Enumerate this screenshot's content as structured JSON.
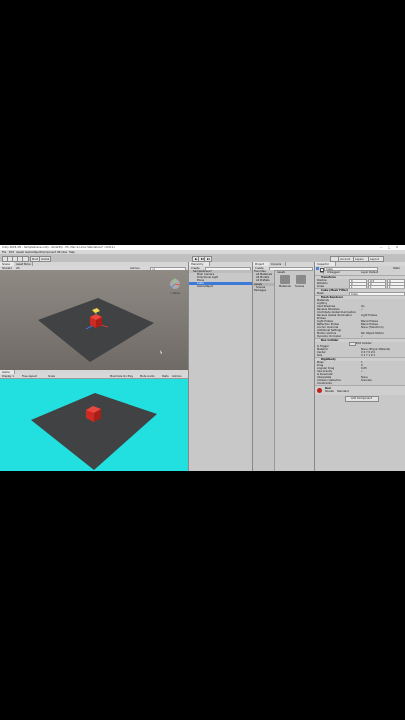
{
  "window": {
    "title": "Unity 2018.4f1 - SampleScene.unity - NodeTrip - PC, Mac & Linux Standalone* <DX11>",
    "controls": [
      "—",
      "□",
      "✕"
    ]
  },
  "menu": [
    "File",
    "Edit",
    "Assets",
    "GameObject",
    "Component",
    "Window",
    "Help"
  ],
  "toolbar": {
    "pivot_label": "Pivot",
    "global_label": "Global",
    "account_label": "Account",
    "layers_label": "Layers",
    "layout_label": "Layout"
  },
  "scene_view": {
    "tabs": [
      "Scene",
      "Asset Store"
    ],
    "shading_label": "Shaded",
    "mode_label": "2D",
    "gizmos_label": "Gizmos",
    "search_placeholder": "All",
    "persp_label": "< Persp"
  },
  "game_view": {
    "tabs": [
      "Game"
    ],
    "display_label": "Display 1",
    "aspect_label": "Free Aspect",
    "scale_label": "Scale",
    "maximize_label": "Maximize On Play",
    "mute_label": "Mute Audio",
    "stats_label": "Stats",
    "gizmos_label": "Gizmos",
    "background_color": "#22e0e0"
  },
  "hierarchy": {
    "tab_label": "Hierarchy",
    "create_label": "Create",
    "scene_name": "SampleScene*",
    "items": [
      "Main Camera",
      "Directional Light",
      "Plane",
      "Cube",
      "GameObject"
    ],
    "selected_item": "Cube"
  },
  "project": {
    "tab_label": "Project",
    "console_label": "Console",
    "create_label": "Create",
    "breadcrumb": "Assets",
    "tree": [
      "Favorites",
      "All Materials",
      "All Models",
      "All Prefabs",
      "Assets",
      "Scenes",
      "Packages"
    ],
    "assets": [
      "Materials",
      "Scenes"
    ]
  },
  "inspector": {
    "tab_label": "Inspector",
    "name": "Cube",
    "static_label": "Static",
    "tag_label": "Tag",
    "tag_value": "Untagged",
    "layer_label": "Layer",
    "layer_value": "Default",
    "transform": {
      "title": "Transform",
      "position_label": "Position",
      "rotation_label": "Rotation",
      "scale_label": "Scale",
      "position": [
        "0",
        "0.5",
        "0"
      ],
      "rotation": [
        "0",
        "0",
        "0"
      ],
      "scale": [
        "1",
        "1",
        "1"
      ]
    },
    "mesh_filter": {
      "title": "Cube (Mesh Filter)",
      "mesh_label": "Mesh",
      "mesh_value": "Cube"
    },
    "mesh_renderer": {
      "title": "Mesh Renderer",
      "rows": [
        [
          "Materials",
          ""
        ],
        [
          "Lighting",
          ""
        ],
        [
          "Cast Shadows",
          "On"
        ],
        [
          "Receive Shadows",
          "✓"
        ],
        [
          "Contribute Global Illumination",
          ""
        ],
        [
          "Receive Global Illumination",
          "Light Probes"
        ],
        [
          "Probes",
          ""
        ],
        [
          "Light Probes",
          "Blend Probes"
        ],
        [
          "Reflection Probes",
          "Blend Probes"
        ],
        [
          "Anchor Override",
          "None (Transform)"
        ],
        [
          "Additional Settings",
          ""
        ],
        [
          "Motion Vectors",
          "Per Object Motion"
        ],
        [
          "Dynamic Occluded",
          "✓"
        ]
      ]
    },
    "box_collider": {
      "title": "Box Collider",
      "edit_label": "Edit Collider",
      "rows": [
        [
          "Is Trigger",
          ""
        ],
        [
          "Material",
          "None (Physic Material)"
        ],
        [
          "Center",
          "X 0  Y 0  Z 0"
        ],
        [
          "Size",
          "X 1  Y 1  Z 1"
        ]
      ]
    },
    "rigidbody": {
      "title": "Rigidbody",
      "rows": [
        [
          "Mass",
          "1"
        ],
        [
          "Drag",
          "0"
        ],
        [
          "Angular Drag",
          "0.05"
        ],
        [
          "Use Gravity",
          "✓"
        ],
        [
          "Is Kinematic",
          ""
        ],
        [
          "Interpolate",
          "None"
        ],
        [
          "Collision Detection",
          "Discrete"
        ],
        [
          "Constraints",
          ""
        ]
      ]
    },
    "material": {
      "name": "Red",
      "shader_label": "Shader",
      "shader_value": "Standard"
    },
    "add_component_label": "Add Component"
  }
}
